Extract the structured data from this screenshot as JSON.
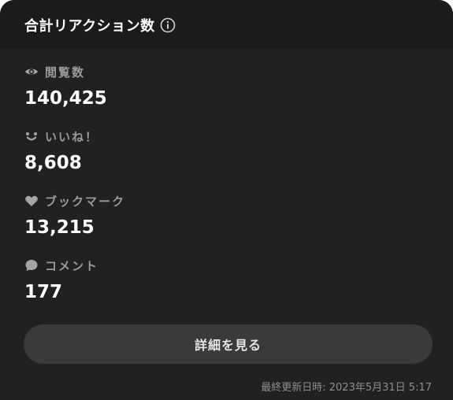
{
  "header": {
    "title": "合計リアクション数"
  },
  "stats": {
    "views": {
      "label": "閲覧数",
      "value": "140,425",
      "icon": "eye-icon"
    },
    "likes": {
      "label": "いいね！",
      "value": "8,608",
      "icon": "smile-icon"
    },
    "bookmarks": {
      "label": "ブックマーク",
      "value": "13,215",
      "icon": "heart-icon"
    },
    "comments": {
      "label": "コメント",
      "value": "177",
      "icon": "speech-bubble-icon"
    }
  },
  "actions": {
    "details_label": "詳細を見る"
  },
  "footer": {
    "updated_text": "最終更新日時: 2023年5月31日 5:17"
  },
  "colors": {
    "card_background": "#212121",
    "header_background": "#1b1b1b",
    "button_background": "#3a3a3a",
    "label_color": "#9a9a9a",
    "value_color": "#ffffff"
  }
}
